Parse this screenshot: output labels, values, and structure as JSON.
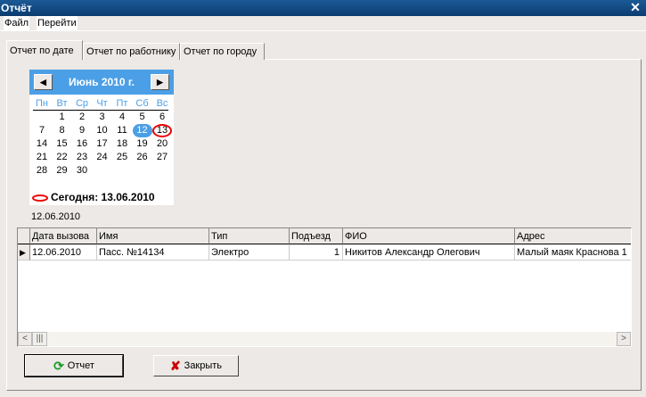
{
  "window": {
    "title": "Отчёт",
    "close": "✕"
  },
  "menu": [
    "Файл",
    "Перейти"
  ],
  "tabs": [
    "Отчет по дате",
    "Отчет по работнику",
    "Отчет по городу"
  ],
  "calendar": {
    "title": "Июнь 2010 г.",
    "prev": "◀",
    "next": "▶",
    "weekdays": [
      "Пн",
      "Вт",
      "Ср",
      "Чт",
      "Пт",
      "Сб",
      "Вс"
    ],
    "weeks": [
      [
        "",
        "1",
        "2",
        "3",
        "4",
        "5",
        "6"
      ],
      [
        "7",
        "8",
        "9",
        "10",
        "11",
        "12",
        "13"
      ],
      [
        "14",
        "15",
        "16",
        "17",
        "18",
        "19",
        "20"
      ],
      [
        "21",
        "22",
        "23",
        "24",
        "25",
        "26",
        "27"
      ],
      [
        "28",
        "29",
        "30",
        "",
        "",
        "",
        ""
      ]
    ],
    "selected": "12",
    "today": "13",
    "today_label": "Сегодня: 13.06.2010",
    "colors": {
      "header": "#4b9fe6",
      "today_circle": "#e00000"
    }
  },
  "selected_date": "12.06.2010",
  "grid": {
    "columns": [
      "Дата вызова",
      "Имя",
      "Тип",
      "Подъезд",
      "ФИО",
      "Адрес"
    ],
    "rows": [
      [
        "12.06.2010",
        "Пасс. №14134",
        "Электро",
        "1",
        "Никитов Александр Олегович",
        "Малый маяк Краснова 1"
      ]
    ]
  },
  "buttons": {
    "report": "Отчет",
    "close": "Закрыть"
  }
}
